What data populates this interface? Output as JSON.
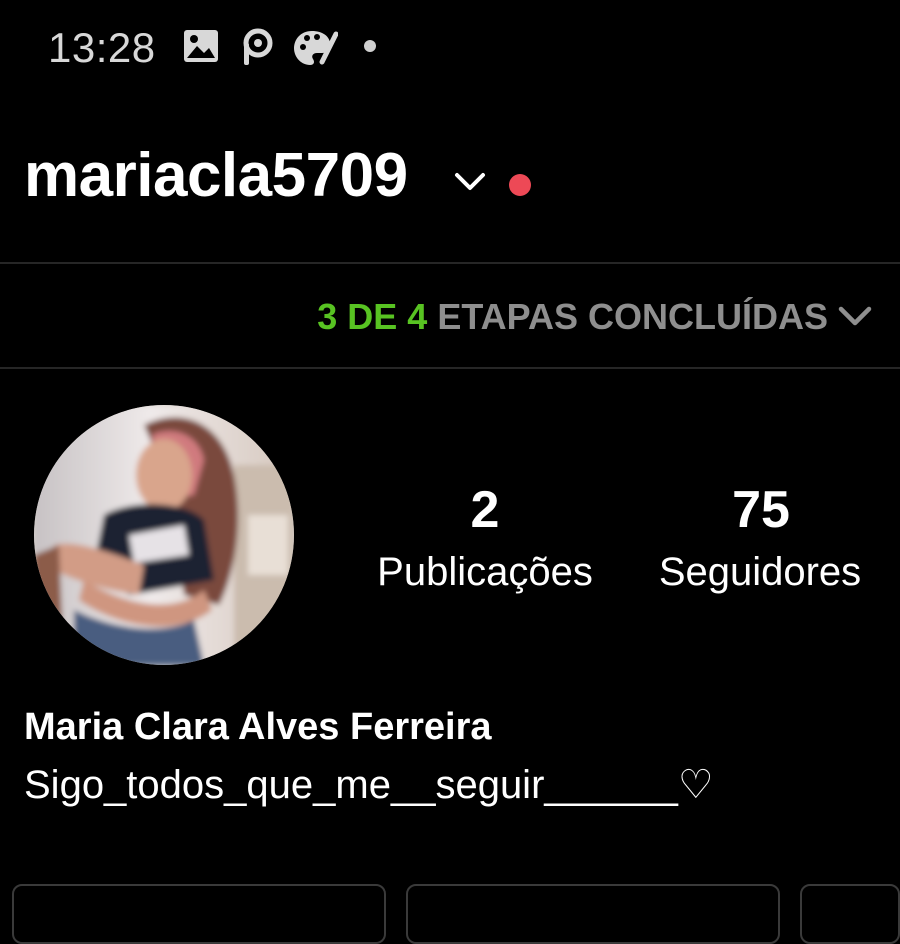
{
  "status_bar": {
    "time": "13:28",
    "icons": [
      "gallery-icon",
      "picsart-icon",
      "palette-icon",
      "more-dot-icon"
    ]
  },
  "header": {
    "username": "mariacla5709",
    "chevron_icon": "chevron-down-icon",
    "notification_color": "#ed4956"
  },
  "steps": {
    "done_text": "3 DE 4",
    "rest_text": " ETAPAS CONCLUÍDAS",
    "done_color": "#58c322",
    "rest_color": "#8e8e8e",
    "chevron_icon": "chevron-down-icon"
  },
  "profile": {
    "avatar_icon": "profile-photo",
    "stats": [
      {
        "value": "2",
        "label": "Publicações"
      },
      {
        "value": "75",
        "label": "Seguidores"
      }
    ],
    "full_name": "Maria Clara Alves Ferreira",
    "bio": "Sigo_todos_que_me__seguir______♡"
  },
  "actions": {
    "buttons": [
      "",
      "",
      ""
    ]
  }
}
